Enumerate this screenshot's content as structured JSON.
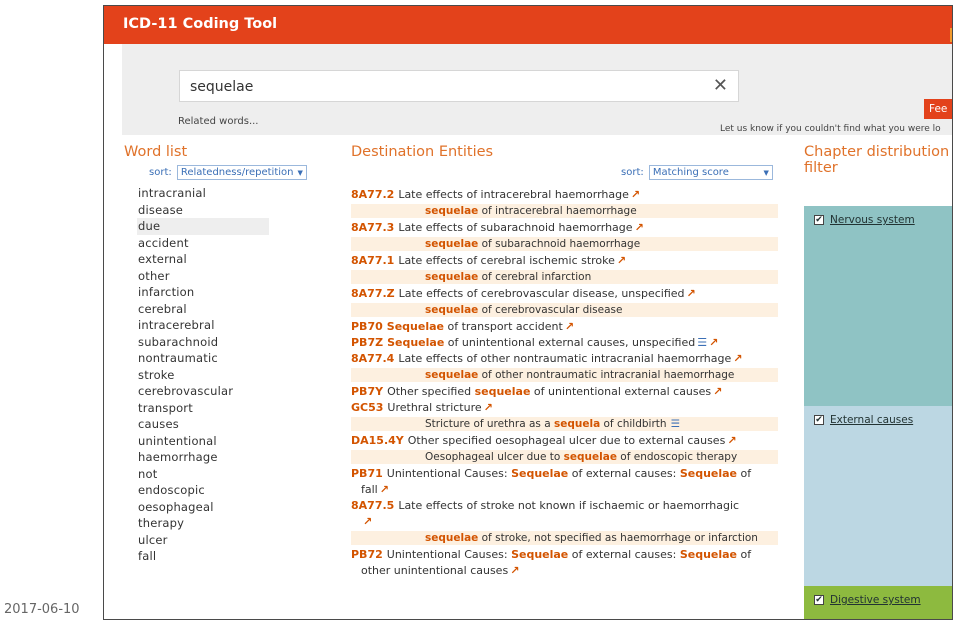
{
  "app": {
    "title": "ICD-11 Coding Tool"
  },
  "search": {
    "value": "sequelae",
    "clear_label": "✕",
    "related_words": "Related words...",
    "feedback_label": "Fee",
    "feedback_note": "Let us know if you couldn't find what you were lo"
  },
  "wordlist": {
    "heading": "Word list",
    "sort_label": "sort:",
    "sort_value": "Relatedness/repetition",
    "items": [
      {
        "label": "intracranial"
      },
      {
        "label": "disease"
      },
      {
        "label": "due"
      },
      {
        "label": "accident"
      },
      {
        "label": "external"
      },
      {
        "label": "other"
      },
      {
        "label": "infarction"
      },
      {
        "label": "cerebral"
      },
      {
        "label": "intracerebral"
      },
      {
        "label": "subarachnoid"
      },
      {
        "label": "nontraumatic"
      },
      {
        "label": "stroke"
      },
      {
        "label": "cerebrovascular"
      },
      {
        "label": "transport"
      },
      {
        "label": "causes"
      },
      {
        "label": "unintentional"
      },
      {
        "label": "haemorrhage"
      },
      {
        "label": "not"
      },
      {
        "label": "endoscopic"
      },
      {
        "label": "oesophageal"
      },
      {
        "label": "therapy"
      },
      {
        "label": "ulcer"
      },
      {
        "label": "fall"
      }
    ],
    "selected_index": 2
  },
  "destination": {
    "heading": "Destination Entities",
    "sort_label": "sort:",
    "sort_value": "Matching score",
    "entries": [
      {
        "code": "8A77.2",
        "parts": [
          "Late effects of intracerebral haemorrhage"
        ],
        "sub": [
          "sequelae",
          " of intracerebral haemorrhage"
        ]
      },
      {
        "code": "8A77.3",
        "parts": [
          "Late effects of subarachnoid haemorrhage"
        ],
        "sub": [
          "sequelae",
          " of subarachnoid haemorrhage"
        ]
      },
      {
        "code": "8A77.1",
        "parts": [
          "Late effects of cerebral ischemic stroke"
        ],
        "sub": [
          "sequelae",
          " of cerebral infarction"
        ]
      },
      {
        "code": "8A77.Z",
        "parts": [
          "Late effects of cerebrovascular disease, unspecified"
        ],
        "sub": [
          "sequelae",
          " of cerebrovascular disease"
        ]
      },
      {
        "code": "PB70",
        "parts": [
          "",
          "Sequelae",
          " of transport accident"
        ]
      },
      {
        "code": "PB7Z",
        "parts": [
          "",
          "Sequelae",
          " of unintentional external causes, unspecified"
        ],
        "list_icon": true
      },
      {
        "code": "8A77.4",
        "parts": [
          "Late effects of other nontraumatic intracranial haemorrhage"
        ],
        "sub": [
          "sequelae",
          " of other nontraumatic intracranial haemorrhage"
        ]
      },
      {
        "code": "PB7Y",
        "parts": [
          "Other specified ",
          "sequelae",
          " of unintentional external causes"
        ]
      },
      {
        "code": "GC53",
        "parts": [
          "Urethral stricture"
        ],
        "sub_pre": "Stricture of urethra as a ",
        "sub_hl": "sequela",
        "sub_post": " of childbirth"
      },
      {
        "code": "DA15.4Y",
        "parts": [
          "Other specified oesophageal ulcer due to external causes"
        ],
        "sub_pre": "Oesophageal ulcer due to ",
        "sub_hl": "sequelae",
        "sub_post": " of endoscopic therapy"
      },
      {
        "code": "PB71",
        "line1": [
          "Unintentional Causes: ",
          "Sequelae",
          " of external causes: ",
          "Sequelae",
          " of"
        ],
        "line2": "fall"
      },
      {
        "code": "8A77.5",
        "line1": [
          "Late effects of stroke not known if ischaemic or haemorrhagic"
        ],
        "line2": "",
        "sub": [
          "sequelae",
          " of stroke, not specified as haemorrhage or infarction"
        ]
      },
      {
        "code": "PB72",
        "line1": [
          "Unintentional Causes: ",
          "Sequelae",
          " of external causes: ",
          "Sequelae",
          " of"
        ],
        "line2": "other unintentional causes"
      }
    ]
  },
  "chapters": {
    "heading_line1": "Chapter distribution",
    "heading_line2": "filter",
    "items": [
      {
        "label": "Nervous system",
        "color": "#8fc3c4",
        "checked": "✔"
      },
      {
        "label": "External causes",
        "color": "#bcd7e3",
        "checked": "✔"
      },
      {
        "label": "Digestive system",
        "color": "#8dba3f",
        "checked": "✔"
      }
    ]
  },
  "icons": {
    "external_link": "external-link-icon",
    "list": "list-icon",
    "clear": "close-icon"
  },
  "colors": {
    "header": "#e3421b",
    "accent": "#d35400",
    "link": "#3b6fb6"
  },
  "footer": {
    "date": "2017-06-10"
  }
}
